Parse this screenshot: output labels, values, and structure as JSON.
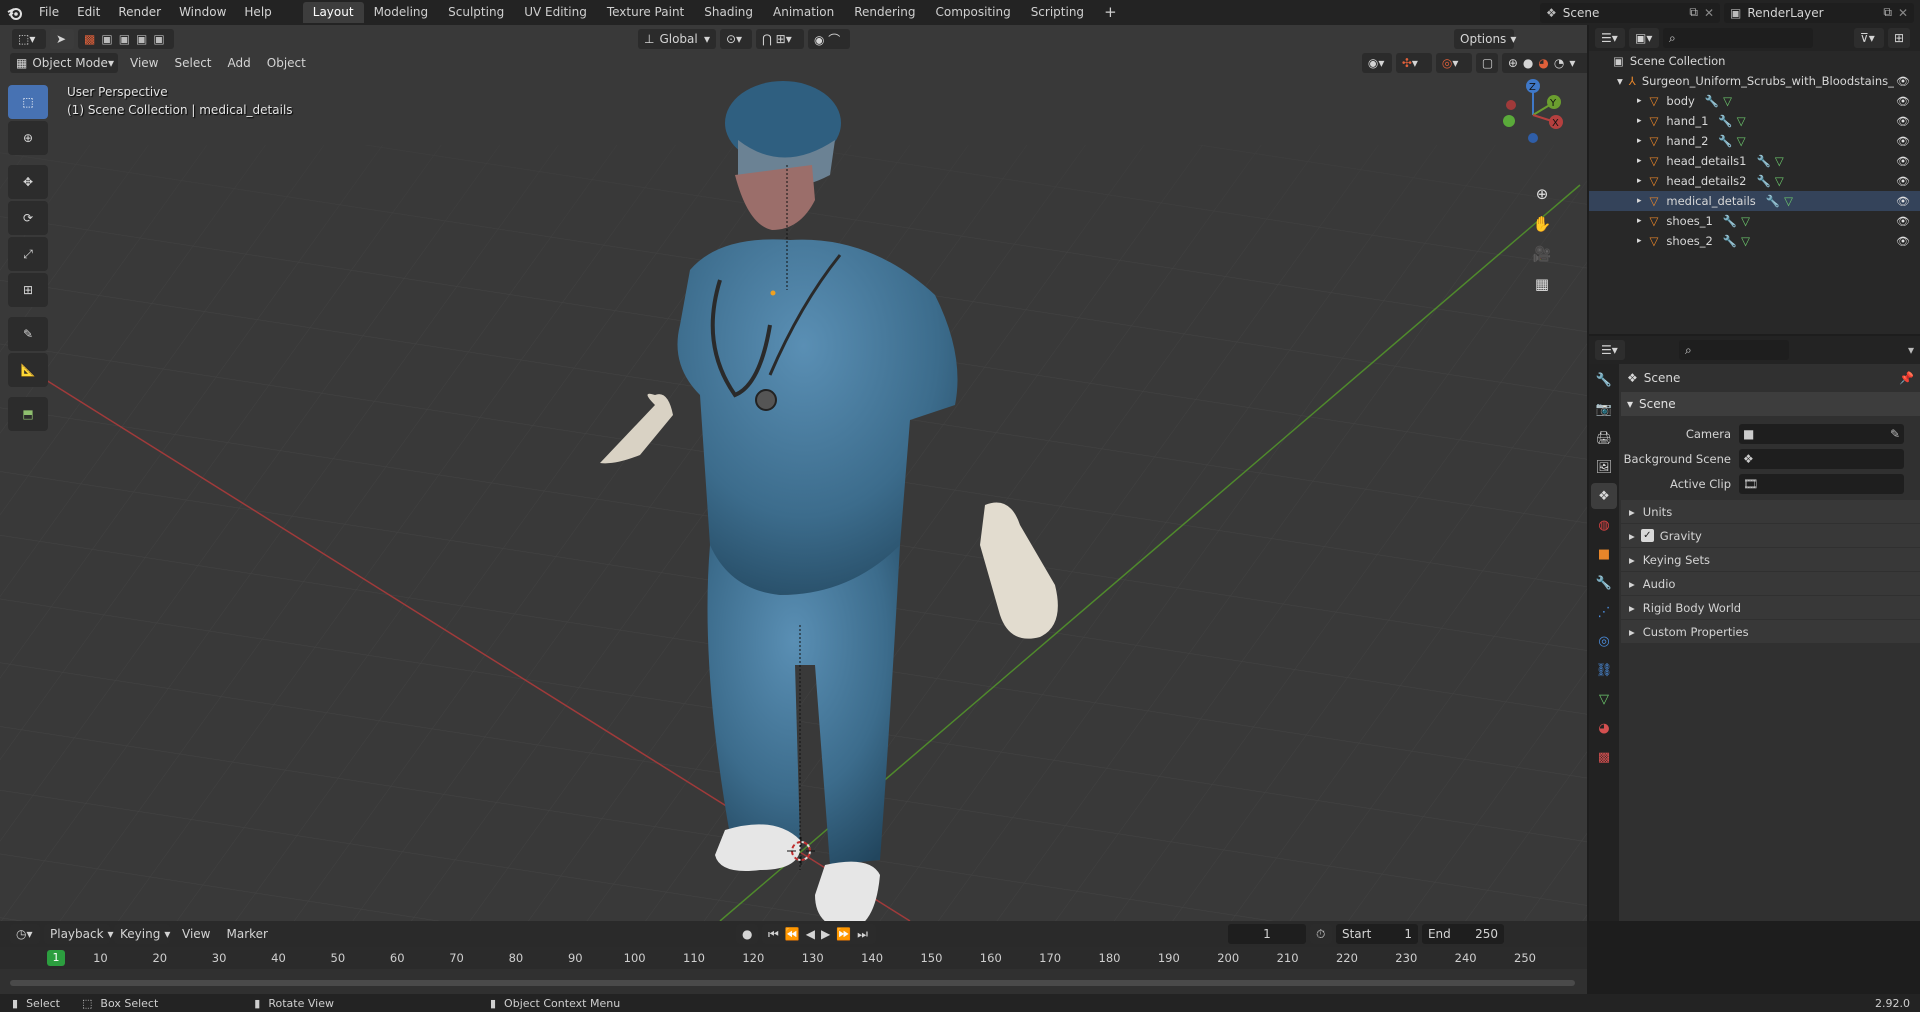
{
  "topbar": {
    "menus": [
      "File",
      "Edit",
      "Render",
      "Window",
      "Help"
    ],
    "workspaces": [
      "Layout",
      "Modeling",
      "Sculpting",
      "UV Editing",
      "Texture Paint",
      "Shading",
      "Animation",
      "Rendering",
      "Compositing",
      "Scripting"
    ],
    "active_workspace": "Layout",
    "add_workspace": "+",
    "scene_name": "Scene",
    "view_layer_name": "RenderLayer"
  },
  "viewport_header": {
    "mode": "Object Mode",
    "menus": [
      "View",
      "Select",
      "Add",
      "Object"
    ],
    "orientation": "Global",
    "options_label": "Options"
  },
  "viewport": {
    "perspective_label": "User Perspective",
    "collection_label": "(1) Scene Collection | medical_details",
    "gizmo_axes": {
      "x": "X",
      "y": "Y",
      "z": "Z"
    }
  },
  "outliner": {
    "root": "Scene Collection",
    "parent": "Surgeon_Uniform_Scrubs_with_Bloodstains_",
    "children": [
      "body",
      "hand_1",
      "hand_2",
      "head_details1",
      "head_details2",
      "medical_details",
      "shoes_1",
      "shoes_2"
    ],
    "selected": "medical_details"
  },
  "properties": {
    "context": "Scene",
    "panel_title": "Scene",
    "fields": [
      {
        "label": "Camera",
        "value": ""
      },
      {
        "label": "Background Scene",
        "value": ""
      },
      {
        "label": "Active Clip",
        "value": ""
      }
    ],
    "subpanels": [
      "Units",
      "Gravity",
      "Keying Sets",
      "Audio",
      "Rigid Body World",
      "Custom Properties"
    ],
    "gravity_checked": true
  },
  "timeline": {
    "menus": [
      "Playback",
      "Keying",
      "View",
      "Marker"
    ],
    "current_frame": "1",
    "start_label": "Start",
    "start": "1",
    "end_label": "End",
    "end": "250",
    "ticks": [
      "10",
      "20",
      "30",
      "40",
      "50",
      "60",
      "70",
      "80",
      "90",
      "100",
      "110",
      "120",
      "130",
      "140",
      "150",
      "160",
      "170",
      "180",
      "190",
      "200",
      "210",
      "220",
      "230",
      "240",
      "250"
    ],
    "playhead_label": "1"
  },
  "statusbar": {
    "items": [
      "Select",
      "Box Select",
      "Rotate View",
      "Object Context Menu"
    ],
    "version": "2.92.0"
  },
  "colors": {
    "accent": "#4772b3",
    "selected_row": "#34435a",
    "orange_object": "#e8862a",
    "x_axis": "#b5403f",
    "y_axis": "#6b9e2f",
    "z_axis": "#3f78c8",
    "playhead": "#2c9e3f"
  }
}
